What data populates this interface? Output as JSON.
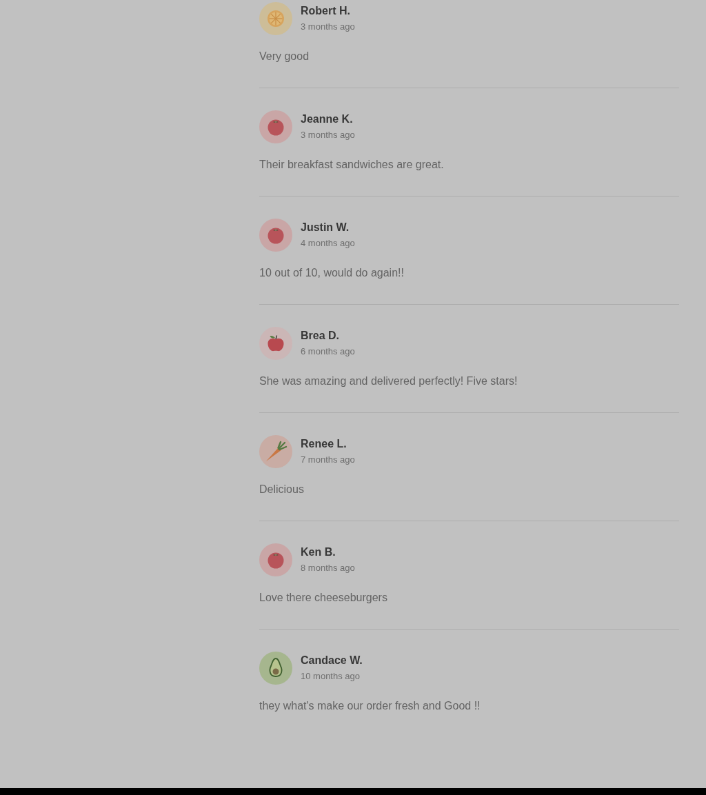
{
  "reviews": [
    {
      "name": "Robert H.",
      "time": "3 months ago",
      "text": "Very good",
      "kind": "lemon"
    },
    {
      "name": "Jeanne K.",
      "time": "3 months ago",
      "text": "Their breakfast sandwiches are great.",
      "kind": "tomato"
    },
    {
      "name": "Justin W.",
      "time": "4 months ago",
      "text": "10 out of 10, would do again!!",
      "kind": "tomato"
    },
    {
      "name": "Brea D.",
      "time": "6 months ago",
      "text": "She was amazing and delivered perfectly! Five stars!",
      "kind": "apple"
    },
    {
      "name": "Renee L.",
      "time": "7 months ago",
      "text": "Delicious",
      "kind": "carrot"
    },
    {
      "name": "Ken B.",
      "time": "8 months ago",
      "text": "Love there cheeseburgers",
      "kind": "tomato"
    },
    {
      "name": "Candace W.",
      "time": "10 months ago",
      "text": "they what's make our order fresh and Good !!",
      "kind": "avocado"
    }
  ]
}
